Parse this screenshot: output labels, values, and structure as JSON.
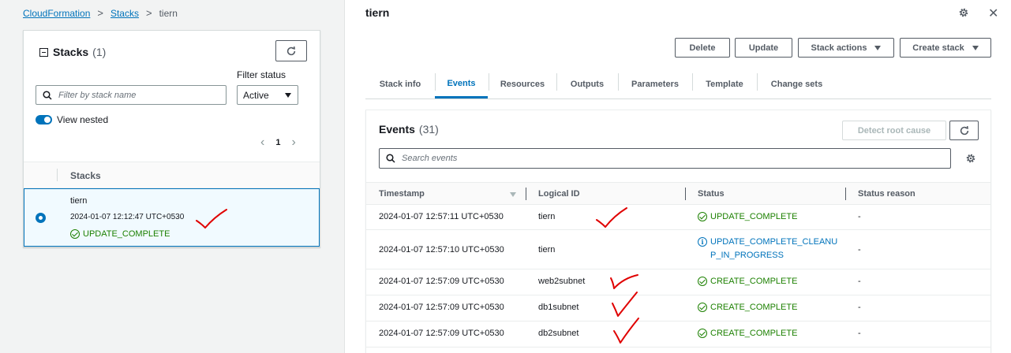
{
  "breadcrumbs": [
    "CloudFormation",
    "Stacks",
    "tiern"
  ],
  "left": {
    "title": "Stacks",
    "count": "(1)",
    "filter_status_label": "Filter status",
    "search_placeholder": "Filter by stack name",
    "filter_status_value": "Active",
    "view_nested_label": "View nested",
    "view_nested_on": true,
    "page": "1",
    "column_header": "Stacks",
    "stack": {
      "name": "tiern",
      "time": "2024-01-07 12:12:47 UTC+0530",
      "status": "UPDATE_COMPLETE",
      "selected": true
    }
  },
  "right": {
    "title": "tiern",
    "buttons": {
      "delete": "Delete",
      "update": "Update",
      "stack_actions": "Stack actions",
      "create_stack": "Create stack"
    },
    "tabs": [
      "Stack info",
      "Events",
      "Resources",
      "Outputs",
      "Parameters",
      "Template",
      "Change sets"
    ],
    "active_tab": "Events",
    "events": {
      "title": "Events",
      "count": "(31)",
      "detect_root_cause": "Detect root cause",
      "search_placeholder": "Search events",
      "columns": [
        "Timestamp",
        "Logical ID",
        "Status",
        "Status reason"
      ],
      "rows": [
        {
          "timestamp": "2024-01-07 12:57:11 UTC+0530",
          "logical_id": "tiern",
          "status_line1": "UPDATE_COMPLETE",
          "status_line2": "",
          "status_kind": "success",
          "reason": "-"
        },
        {
          "timestamp": "2024-01-07 12:57:10 UTC+0530",
          "logical_id": "tiern",
          "status_line1": "UPDATE_COMPLETE_CLEANU",
          "status_line2": "P_IN_PROGRESS",
          "status_kind": "info",
          "reason": "-"
        },
        {
          "timestamp": "2024-01-07 12:57:09 UTC+0530",
          "logical_id": "web2subnet",
          "status_line1": "CREATE_COMPLETE",
          "status_line2": "",
          "status_kind": "success",
          "reason": "-"
        },
        {
          "timestamp": "2024-01-07 12:57:09 UTC+0530",
          "logical_id": "db1subnet",
          "status_line1": "CREATE_COMPLETE",
          "status_line2": "",
          "status_kind": "success",
          "reason": "-"
        },
        {
          "timestamp": "2024-01-07 12:57:09 UTC+0530",
          "logical_id": "db2subnet",
          "status_line1": "CREATE_COMPLETE",
          "status_line2": "",
          "status_kind": "success",
          "reason": "-"
        }
      ]
    }
  },
  "colors": {
    "link": "#0073bb",
    "success": "#1d8102",
    "annotation": "#e00000"
  }
}
